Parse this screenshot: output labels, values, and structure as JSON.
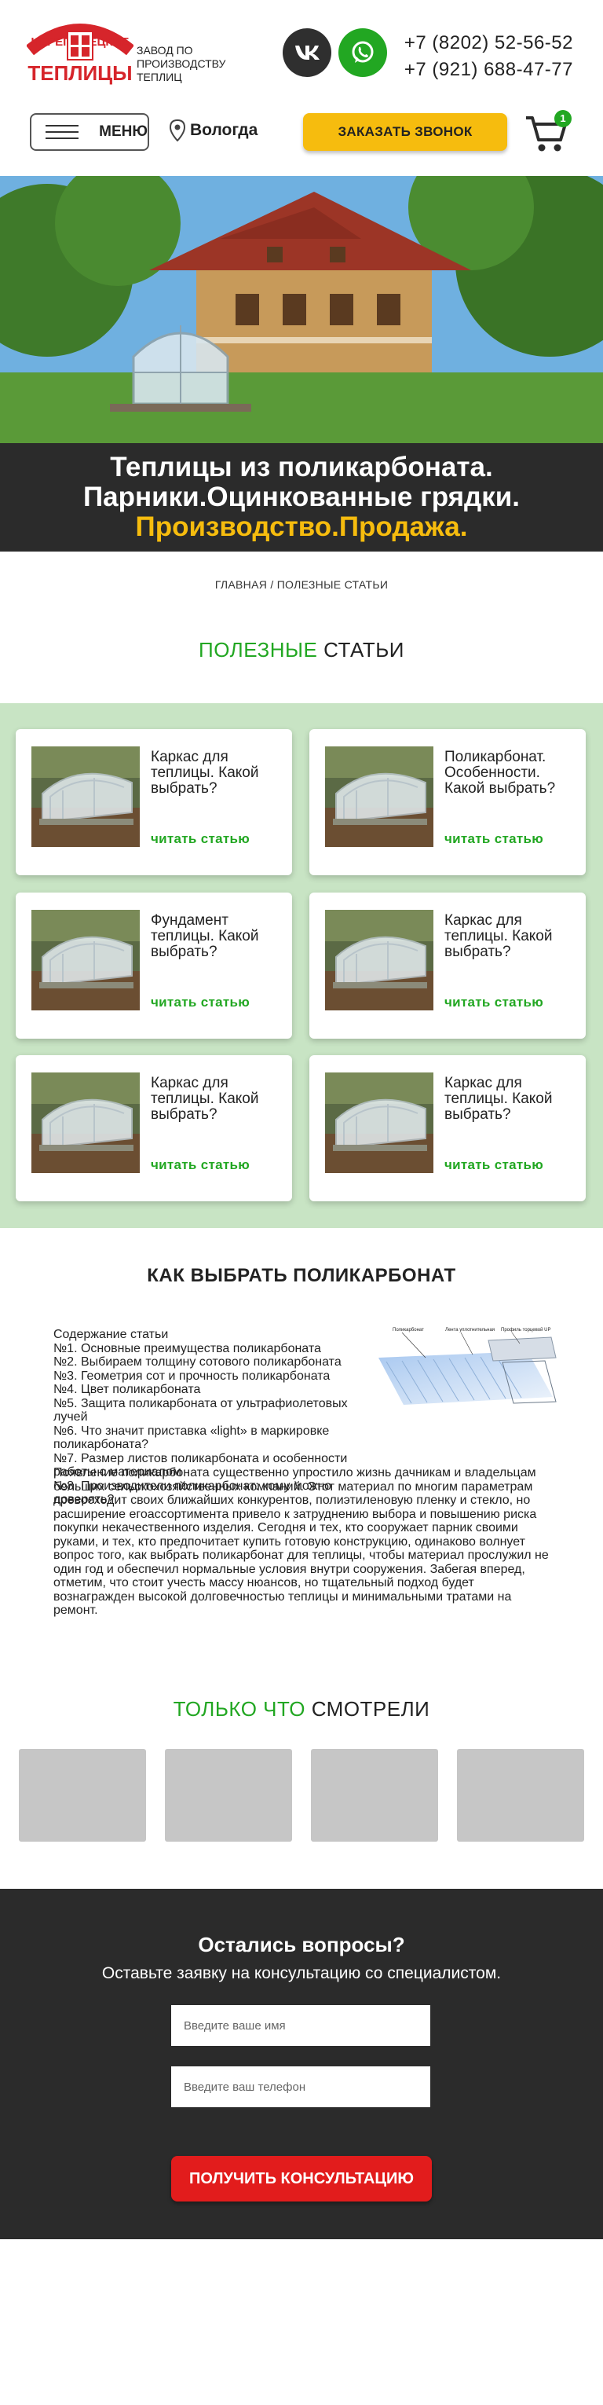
{
  "header": {
    "logo_line1": "ЧЕРЕПОВЕЦКИЕ",
    "logo_line2": "ТЕПЛИЦЫ",
    "tagline": "ЗАВОД ПО ПРОИЗВОДСТВУ ТЕПЛИЦ",
    "phone1": "+7 (8202) 52-56-52",
    "phone2": "+7 (921) 688-47-77",
    "menu_label": "МЕНЮ",
    "city": "Вологда",
    "call_button": "ЗАКАЗАТЬ ЗВОНОК",
    "cart_count": "1",
    "social": [
      "vk-icon",
      "whatsapp-icon"
    ]
  },
  "hero": {
    "line1": "Теплицы из поликарбоната.",
    "line2": "Парники.Оцинкованные грядки.",
    "line3": "Производство.Продажа."
  },
  "breadcrumb": "ГЛАВНАЯ / ПОЛЕЗНЫЕ СТАТЬИ",
  "articles_section": {
    "title_green": "ПОЛЕЗНЫЕ",
    "title_rest": "СТАТЬИ",
    "read_label": "читать статью",
    "cards": [
      {
        "title": "Каркас для теплицы. Какой выбрать?"
      },
      {
        "title": "Поликарбонат. Особенности. Какой выбрать?"
      },
      {
        "title": "Фундамент теплицы. Какой выбрать?"
      },
      {
        "title": "Каркас для теплицы. Какой выбрать?"
      },
      {
        "title": "Каркас для теплицы. Какой выбрать?"
      },
      {
        "title": "Каркас для теплицы. Какой выбрать?"
      }
    ]
  },
  "poly_article": {
    "title": "КАК ВЫБРАТЬ ПОЛИКАРБОНАТ",
    "toc_heading": "Содержание статьи",
    "toc": [
      "№1. Основные преимущества поликарбоната",
      "№2. Выбираем толщину сотового поликарбоната",
      "№3. Геометрия сот и прочность поликарбоната",
      "№4. Цвет поликарбоната",
      "№5. Защита поликарбоната от ультрафиолетовых лучей",
      "№6. Что значит приставка «light» в маркировке поликарбоната?",
      "№7. Размер листов поликарбоната и особенности работы с материалом",
      "№8. Производители поликарбонат: кому можно доверять?"
    ],
    "diagram_labels": [
      "Поликарбонат",
      "Лента уплотнительная",
      "Профиль торцевой UP"
    ],
    "body": "Появление поликарбоната существенно упростило жизнь дачникам и владельцам больших сельскохозяйственных компаний. Этот материал по многим параметрам превосходит своих ближайших конкурентов, полиэтиленовую пленку и стекло, но расширение егоассортимента привело к затруднению выбора и повышению риска покупки некачественного изделия. Сегодня и тех, кто сооружает парник своими руками, и тех, кто предпочитает купить готовую конструкцию, одинаково волнует вопрос того, как выбрать поликарбонат для теплицы, чтобы материал прослужил не один год и обеспечил нормальные условия внутри сооружения. Забегая вперед, отметим, что стоит учесть массу нюансов, но тщательный подход будет вознагражден высокой долговечностью теплицы и минимальными тратами на ремонт."
  },
  "recently_viewed": {
    "title_green": "ТОЛЬКО ЧТО",
    "title_rest": "СМОТРЕЛИ"
  },
  "contact_form": {
    "title": "Остались вопросы?",
    "subtitle": "Оставьте заявку на консультацию со специалистом.",
    "name_placeholder": "Введите ваше имя",
    "phone_placeholder": "Введите ваш телефон",
    "submit": "ПОЛУЧИТЬ КОНСУЛЬТАЦИЮ"
  },
  "colors": {
    "accent_green": "#22a722",
    "accent_yellow": "#f6bc0e",
    "logo_red": "#d6252b",
    "dark_band": "#2b2b2b",
    "section_green_bg": "#c8e4c4",
    "consult_red": "#e21c1c"
  }
}
